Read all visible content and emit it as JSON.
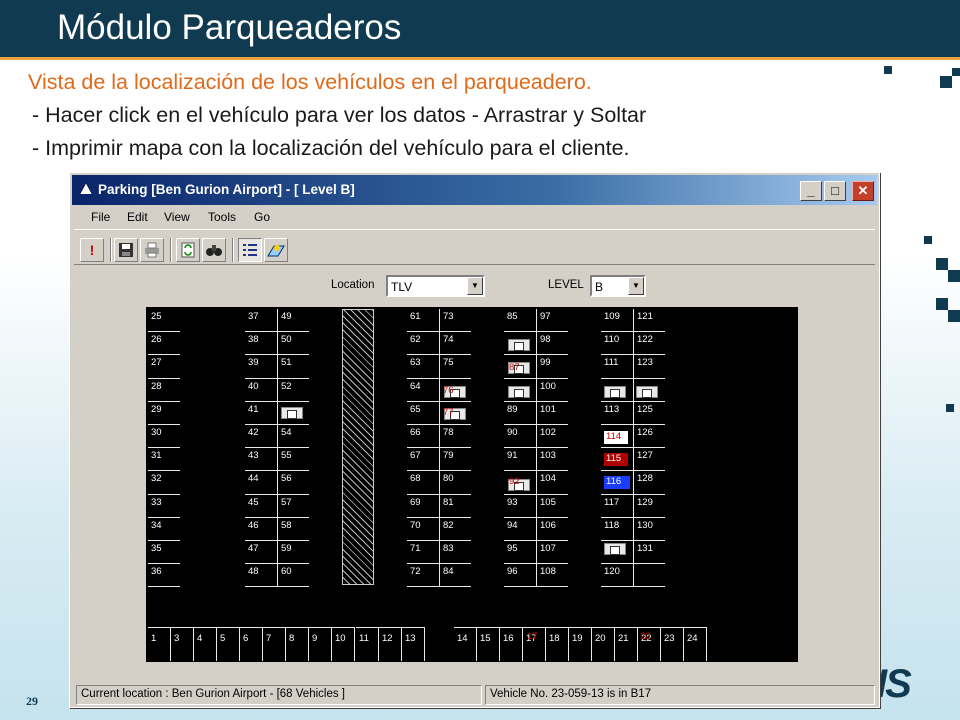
{
  "slide": {
    "title": "Módulo Parqueaderos",
    "bullets": [
      "Vista de la localización de los vehículos en el parqueadero.",
      "- Hacer click en el vehículo para ver los datos - Arrastrar y Soltar",
      "- Imprimir mapa con la localización del vehículo para el cliente."
    ],
    "page_number": "29",
    "brand_logo_text": "IS"
  },
  "window": {
    "title": "Parking [Ben Gurion Airport]   - [ Level B]",
    "controls": {
      "minimize": "_",
      "maximize": "□",
      "close": "✕"
    },
    "menu": [
      "File",
      "Edit",
      "View",
      "Tools",
      "Go"
    ],
    "toolbar_icons": [
      "alert-icon",
      "save-icon",
      "print-icon",
      "refresh-icon",
      "binoculars-icon",
      "list-icon",
      "map-icon"
    ],
    "filters": {
      "location_label": "Location",
      "location_value": "TLV",
      "level_label": "LEVEL",
      "level_value": "B"
    },
    "map": {
      "columns": [
        [
          "25",
          "26",
          "27",
          "28",
          "29",
          "30",
          "31",
          "32",
          "33",
          "34",
          "35",
          "36"
        ],
        [
          "37",
          "38",
          "39",
          "40",
          "41",
          "42",
          "43",
          "44",
          "45",
          "46",
          "47",
          "48"
        ],
        [
          "49",
          "50",
          "51",
          "52",
          "",
          "54",
          "55",
          "56",
          "57",
          "58",
          "59",
          "60"
        ],
        [
          "61",
          "62",
          "63",
          "64",
          "65",
          "66",
          "67",
          "68",
          "69",
          "70",
          "71",
          "72"
        ],
        [
          "73",
          "74",
          "75",
          "",
          "",
          "78",
          "79",
          "80",
          "81",
          "82",
          "83",
          "84"
        ],
        [
          "85",
          "",
          "",
          "",
          "89",
          "90",
          "91",
          "",
          "93",
          "94",
          "95",
          "96"
        ],
        [
          "97",
          "98",
          "99",
          "100",
          "101",
          "102",
          "103",
          "104",
          "105",
          "106",
          "107",
          "108"
        ],
        [
          "109",
          "110",
          "111",
          "",
          "113",
          "",
          "",
          "",
          "117",
          "118",
          "",
          "120"
        ],
        [
          "121",
          "122",
          "123",
          "",
          "125",
          "126",
          "127",
          "128",
          "129",
          "130",
          "131",
          ""
        ]
      ],
      "bottom_row": [
        "1",
        "3",
        "4",
        "5",
        "6",
        "7",
        "8",
        "9",
        "10",
        "11",
        "12",
        "13",
        "14",
        "15",
        "16",
        "17",
        "18",
        "19",
        "20",
        "21",
        "22",
        "23",
        "24"
      ],
      "highlighted": [
        {
          "label": "87",
          "color": "#cc0000"
        },
        {
          "label": "76",
          "color": "#cc0000"
        },
        {
          "label": "77",
          "color": "#cc0000"
        },
        {
          "label": "92",
          "color": "#cc0000"
        },
        {
          "label": "114",
          "color": "#cc0000"
        },
        {
          "label": "115",
          "color": "#cc0000"
        },
        {
          "label": "116",
          "color": "#1a3cff"
        },
        {
          "label": "17",
          "color": "#cc0000"
        },
        {
          "label": "22",
          "color": "#cc0000"
        }
      ]
    },
    "status": {
      "left": "Current location : Ben Gurion Airport - [68  Vehicles ]",
      "right": "Vehicle No. 23-059-13 is in B17"
    }
  }
}
